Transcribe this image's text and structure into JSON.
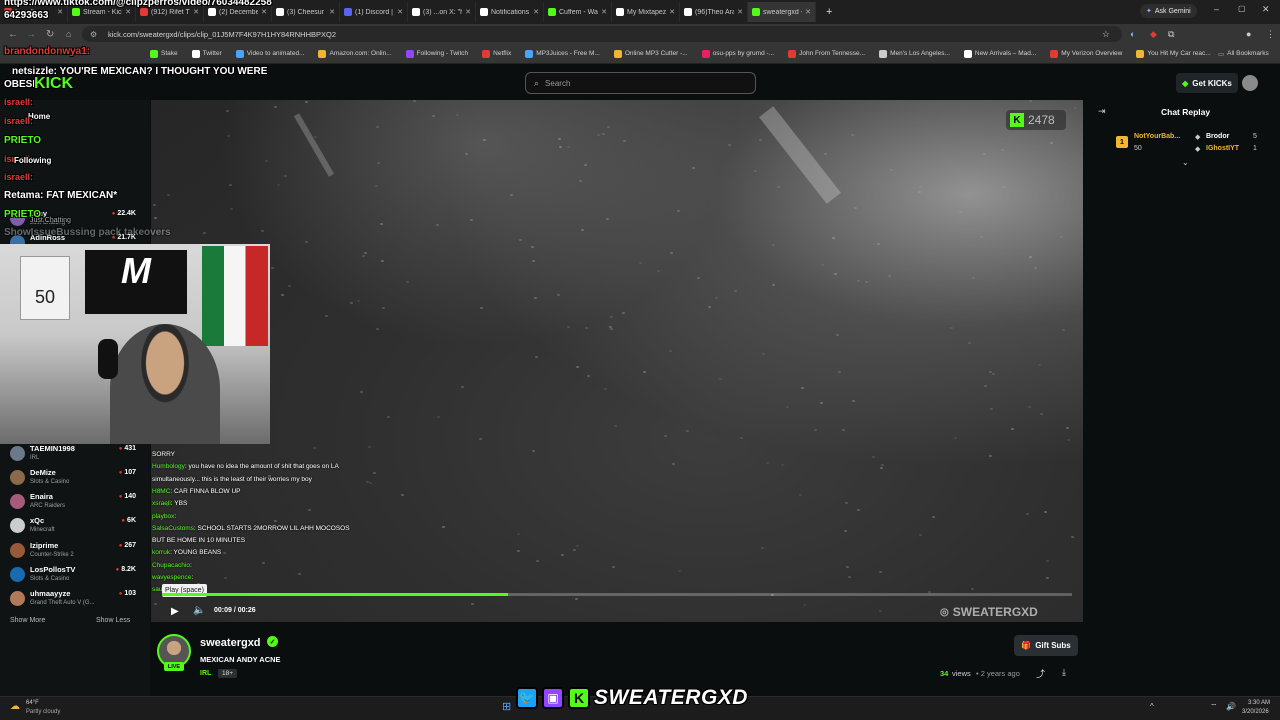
{
  "browser": {
    "tabs": [
      {
        "label": "Israell",
        "color": "#e53935"
      },
      {
        "label": "Stream - Kick Da",
        "color": "#53fc18"
      },
      {
        "label": "(912) Rifet The Fi",
        "color": "#e53935"
      },
      {
        "label": "(2) December on",
        "color": "#ffffff"
      },
      {
        "label": "(3) Cheesur Repo",
        "color": "#ffffff"
      },
      {
        "label": "(1) Discord |",
        "color": "#5865f2"
      },
      {
        "label": "(3) ...on X: \"https:",
        "color": "#ffffff"
      },
      {
        "label": "Notifications / X",
        "color": "#ffffff"
      },
      {
        "label": "Cuffem - Watch",
        "color": "#53fc18"
      },
      {
        "label": "My Mixtapez on",
        "color": "#ffffff"
      },
      {
        "label": "(96)Theo Araujo",
        "color": "#ffffff"
      },
      {
        "label": "sweatergxd - Wa",
        "color": "#53fc18"
      }
    ],
    "new_tab": "+",
    "ask_gemini": "Ask Gemini",
    "url": "kick.com/sweatergxd/clips/clip_01J5M7F4K97H1HY84RNHHBPXQ2",
    "bookmarks": [
      "Stake",
      "Twitter",
      "Video to animated...",
      "Amazon.com: Onlin...",
      "Following - Twitch",
      "Netflix",
      "MP3Juices - Free M...",
      "Online MP3 Cutter -...",
      "osu-pps by grumd -...",
      "John From Tennesse...",
      "Men's Los Angeles...",
      "New Arrivals – Mad...",
      "My Verizon Overview",
      "You Hit My Car reac..."
    ],
    "all_bookmarks": "All Bookmarks"
  },
  "overlay": {
    "tiktok_line1": "https://www.tiktok.com/@clipzperros/video/76034482258",
    "tiktok_line2": "64293663",
    "brandon": "brandondonwya1:",
    "netsizzle_msg": "netsizzle: YOU'RE MEXICAN? I THOUGHT YOU WERE",
    "obese": "OBESE",
    "kick_logo": "KICK",
    "chatter": "israell:",
    "prieto": "PRIETO",
    "fat_mexican": "Retama: FAT MEXICAN*",
    "home": "Home",
    "following": "Following",
    "just_chatting": "Just Chatting",
    "pack_takeovers": "ShowIssueBussing pack takeovers"
  },
  "site": {
    "search_placeholder": "Search",
    "get_kicks": "Get KICKs"
  },
  "sidebar": {
    "channels": [
      {
        "name": "Lacy",
        "category": "Just Chatting",
        "viewers": "22.4K",
        "color": "#7d5fa8"
      },
      {
        "name": "AdinRoss",
        "category": "",
        "viewers": "21.7K",
        "color": "#3a6ea5"
      },
      {
        "name": "TAEMIN1998",
        "category": "IRL",
        "viewers": "431",
        "color": "#6a7a8a"
      },
      {
        "name": "DeMize",
        "category": "Slots & Casino",
        "viewers": "107",
        "color": "#8a6a4a"
      },
      {
        "name": "Enaira",
        "category": "ARC Raiders",
        "viewers": "140",
        "color": "#a85a7a"
      },
      {
        "name": "xQc",
        "category": "Minecraft",
        "viewers": "6K",
        "color": "#cccccc"
      },
      {
        "name": "Iziprime",
        "category": "Counter-Strike 2",
        "viewers": "267",
        "color": "#9a5a3a"
      },
      {
        "name": "LosPollosTV",
        "category": "Slots & Casino",
        "viewers": "8.2K",
        "color": "#1a6ab0"
      },
      {
        "name": "uhmaayyze",
        "category": "Grand Theft Auto V (G...",
        "viewers": "103",
        "color": "#b07a5a"
      }
    ],
    "show_more": "Show More",
    "show_less": "Show Less"
  },
  "player": {
    "kicks_count": "2478",
    "tooltip": "Play (space)",
    "time": "00:09 / 00:26",
    "progress": 0.38,
    "watermark": "SWEATERGXD",
    "chat_overlay": [
      {
        "user": "SORRY",
        "text": ""
      },
      {
        "user": "Humbology",
        "text": ": you have no idea the amount of shit that goes on LA"
      },
      {
        "user": "",
        "text": "simultaneously... this is the least of their worries my boy"
      },
      {
        "user": "H8MC",
        "text": ": CAR FINNA BLOW UP"
      },
      {
        "user": "xsraeli",
        "text": ": YBS"
      },
      {
        "user": "playbox",
        "text": ":"
      },
      {
        "user": "SalsaCustoms",
        "text": ": SCHOOL STARTS 2MORROW LIL AHH MOCOSOS"
      },
      {
        "user": "",
        "text": "BUT BE HOME IN 10 MINUTES"
      },
      {
        "user": "korruk",
        "text": ": YOUNG BEANS"
      },
      {
        "user": "Chupacachio",
        "text": ":"
      },
      {
        "user": "wavyespence",
        "text": ":"
      },
      {
        "user": "saucyyyyy",
        "text": ":"
      }
    ]
  },
  "chat_replay": {
    "title": "Chat Replay",
    "leader_1": {
      "name": "NotYourBab...",
      "amount": "50"
    },
    "leader_2": {
      "name": "Brodor",
      "amount": "5"
    },
    "leader_3": {
      "name": "IGhostIYT",
      "amount": "1"
    }
  },
  "channel": {
    "name": "sweatergxd",
    "live": "LIVE",
    "clip_title": "MEXICAN ANDY ACNE",
    "category": "IRL",
    "age_badge": "18+",
    "gift_subs": "Gift Subs",
    "views_count": "34",
    "views_label": "views",
    "posted": "• 2 years ago"
  },
  "taskbar": {
    "weather_temp": "64°F",
    "weather_desc": "Partly cloudy",
    "banner": "SWEATERGXD",
    "time": "3:30 AM",
    "date": "3/20/2026"
  }
}
